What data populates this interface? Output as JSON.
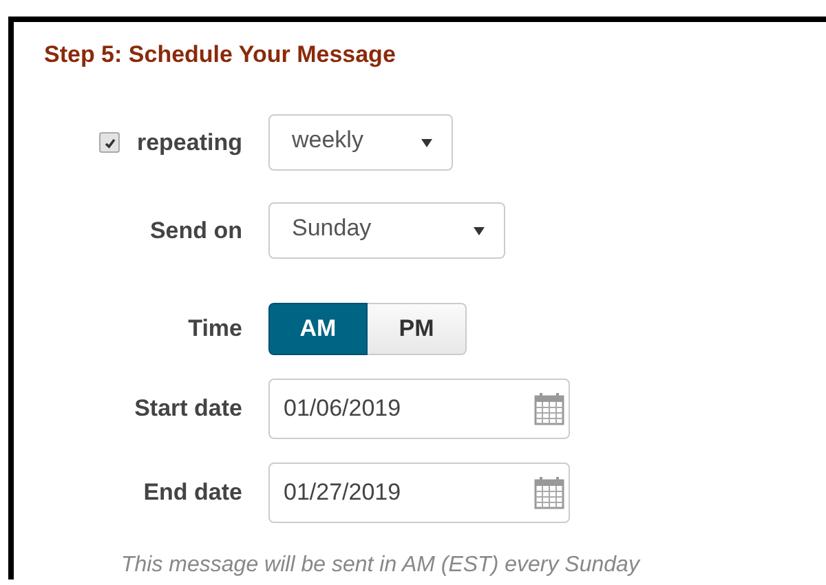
{
  "title": "Step 5: Schedule Your Message",
  "repeat": {
    "label": "repeating",
    "checked": true,
    "value": "weekly"
  },
  "send_on": {
    "label": "Send on",
    "value": "Sunday"
  },
  "time": {
    "label": "Time",
    "options": [
      {
        "label": "AM",
        "selected": true
      },
      {
        "label": "PM",
        "selected": false
      }
    ]
  },
  "start_date": {
    "label": "Start date",
    "value": "01/06/2019"
  },
  "end_date": {
    "label": "End date",
    "value": "01/27/2019"
  },
  "note": "This message will be sent in AM (EST) every Sunday"
}
